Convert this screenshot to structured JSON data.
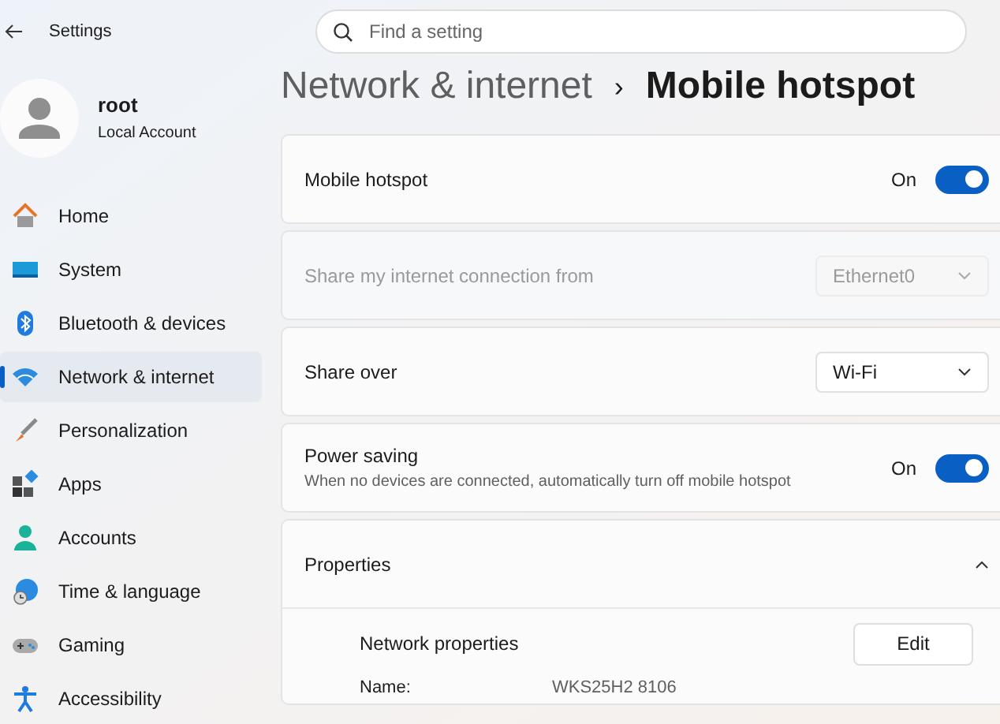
{
  "window": {
    "title": "Settings"
  },
  "search": {
    "placeholder": "Find a setting"
  },
  "account": {
    "name": "root",
    "type": "Local Account"
  },
  "nav": [
    {
      "label": "Home",
      "selected": false
    },
    {
      "label": "System",
      "selected": false
    },
    {
      "label": "Bluetooth & devices",
      "selected": false
    },
    {
      "label": "Network & internet",
      "selected": true
    },
    {
      "label": "Personalization",
      "selected": false
    },
    {
      "label": "Apps",
      "selected": false
    },
    {
      "label": "Accounts",
      "selected": false
    },
    {
      "label": "Time & language",
      "selected": false
    },
    {
      "label": "Gaming",
      "selected": false
    },
    {
      "label": "Accessibility",
      "selected": false
    }
  ],
  "breadcrumb": {
    "parent": "Network & internet",
    "separator": "›",
    "current": "Mobile hotspot"
  },
  "settings": [
    {
      "kind": "toggle",
      "label": "Mobile hotspot",
      "state_label": "On",
      "on": true,
      "disabled": false
    },
    {
      "kind": "dropdown",
      "label": "Share my internet connection from",
      "value": "Ethernet0",
      "disabled": true
    },
    {
      "kind": "dropdown",
      "label": "Share over",
      "value": "Wi-Fi",
      "disabled": false
    },
    {
      "kind": "toggle",
      "label": "Power saving",
      "description": "When no devices are connected, automatically turn off mobile hotspot",
      "state_label": "On",
      "on": true,
      "disabled": false
    },
    {
      "kind": "expander",
      "label": "Properties",
      "expanded": true,
      "action_label": "Network properties",
      "action_button": "Edit",
      "fields": [
        {
          "name": "Name:",
          "value": "WKS25H2 8106"
        }
      ]
    }
  ]
}
